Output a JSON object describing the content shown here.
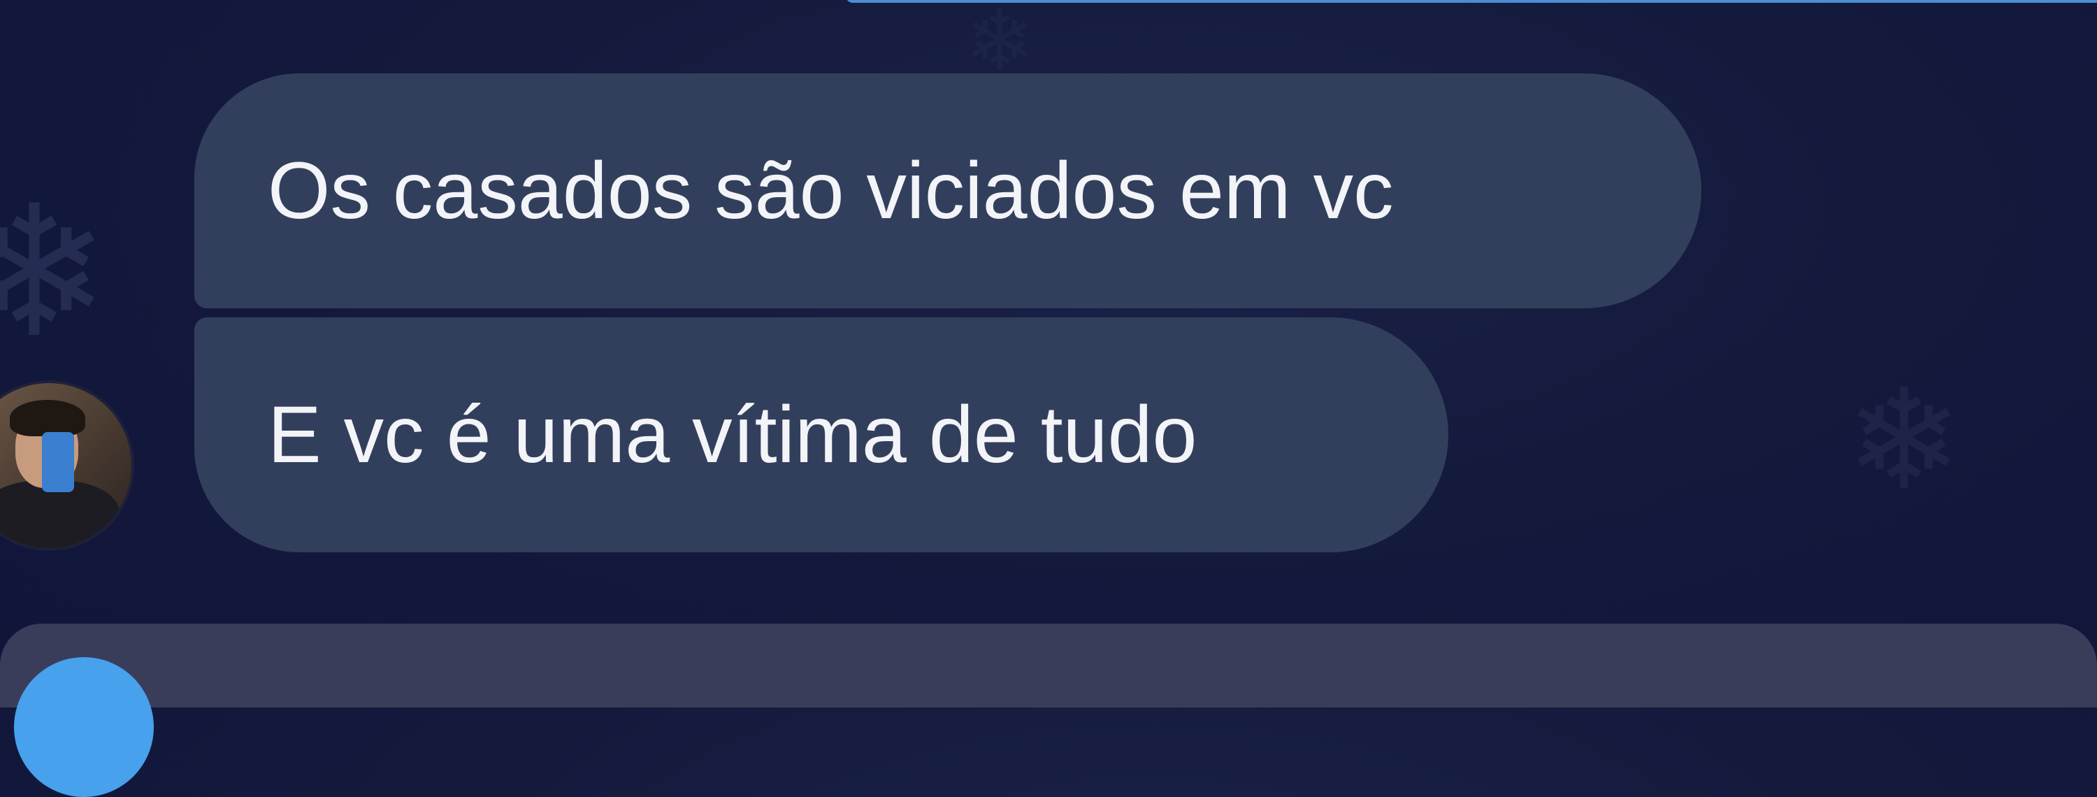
{
  "chat": {
    "messages": [
      {
        "sender": "other",
        "text": "Os casados são viciados em vc"
      },
      {
        "sender": "other",
        "text": "E vc é uma vítima de tudo"
      }
    ]
  },
  "icons": {
    "avatar": "avatar",
    "background_decoration": "snowflake-icon",
    "attach_button": "circle-button"
  },
  "colors": {
    "background": "#141a3c",
    "bubble_incoming": "#323f5c",
    "bubble_text": "#f2f4f8",
    "accent_top_strip": "#4a8fd6",
    "input_bar": "#3a3d59",
    "attach_button": "#47a1ec"
  }
}
